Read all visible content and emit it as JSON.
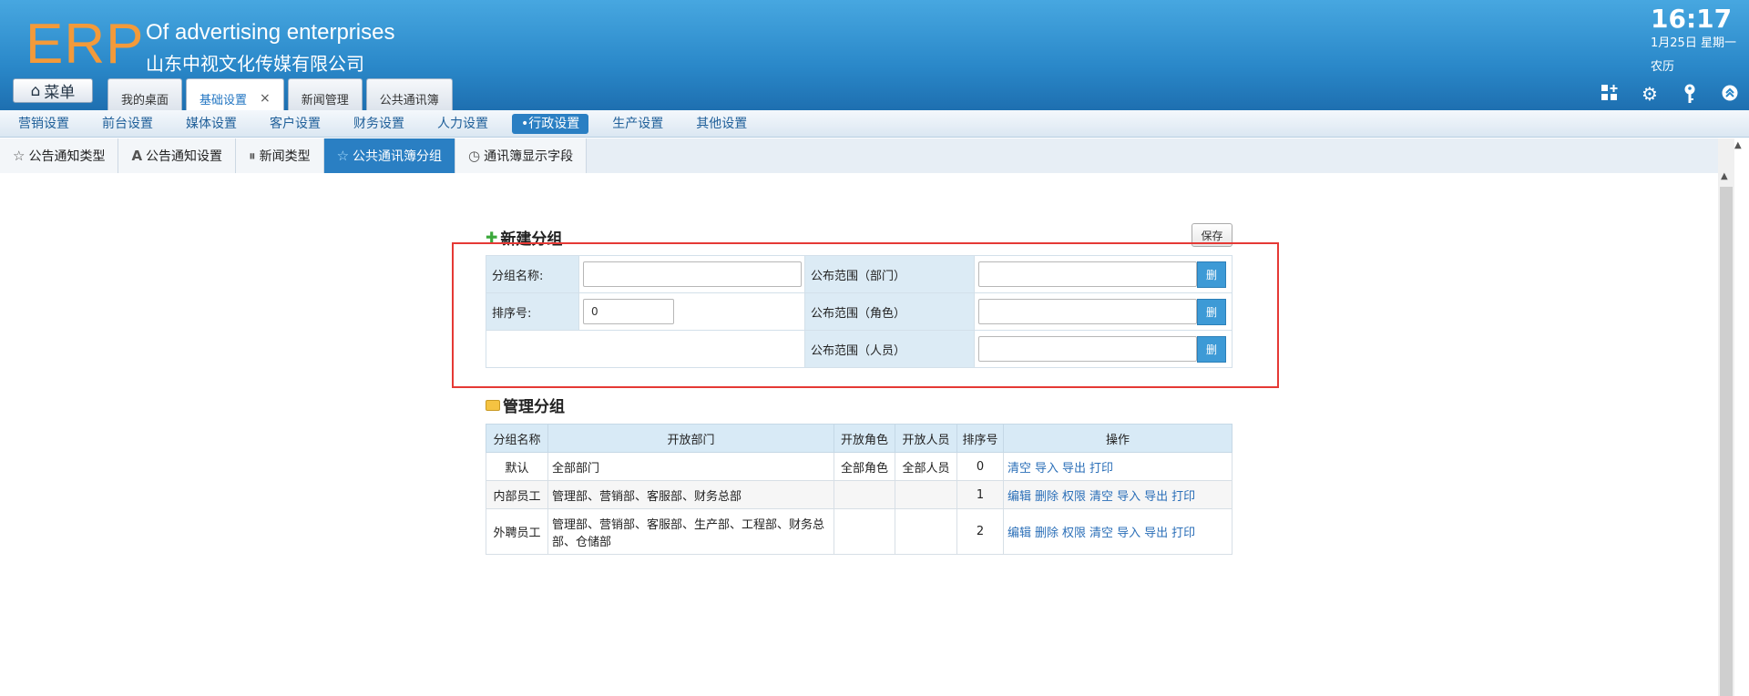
{
  "header": {
    "logo": "ERP",
    "brand_en": "Of advertising enterprises",
    "brand_cn": "山东中视文化传媒有限公司",
    "time": "16:17",
    "date": "1月25日 星期一",
    "lunar": "农历",
    "menu_label": "菜单",
    "tabs": [
      {
        "label": "我的桌面"
      },
      {
        "label": "基础设置",
        "close": "×"
      },
      {
        "label": "新闻管理"
      },
      {
        "label": "公共通讯簿"
      }
    ],
    "icons": [
      "grid-add-icon",
      "gear-icon",
      "key-icon",
      "collapse-up-icon"
    ]
  },
  "settings_nav": [
    "营销设置",
    "前台设置",
    "媒体设置",
    "客户设置",
    "财务设置",
    "人力设置",
    "•行政设置",
    "生产设置",
    "其他设置"
  ],
  "sub_tabs": [
    "公告通知类型",
    "公告通知设置",
    "新闻类型",
    "公共通讯簿分组",
    "通讯簿显示字段"
  ],
  "new_group": {
    "title": "新建分组",
    "save_label": "保存",
    "name_label": "分组名称:",
    "sort_label": "排序号:",
    "sort_value": "0",
    "dept_label": "公布范围（部门）",
    "role_label": "公布范围（角色）",
    "person_label": "公布范围（人员）",
    "select_label": "删"
  },
  "manage": {
    "title": "管理分组",
    "headers": [
      "分组名称",
      "开放部门",
      "开放角色",
      "开放人员",
      "排序号",
      "操作"
    ],
    "rows": [
      {
        "name": "默认",
        "dept": "全部部门",
        "role": "全部角色",
        "person": "全部人员",
        "sort": "0",
        "ops": [
          "清空",
          "导入",
          "导出",
          "打印"
        ]
      },
      {
        "name": "内部员工",
        "dept": "管理部、营销部、客服部、财务总部",
        "role": "",
        "person": "",
        "sort": "1",
        "ops": [
          "编辑",
          "删除",
          "权限",
          "清空",
          "导入",
          "导出",
          "打印"
        ]
      },
      {
        "name": "外聘员工",
        "dept": "管理部、营销部、客服部、生产部、工程部、财务总部、仓储部",
        "role": "",
        "person": "",
        "sort": "2",
        "ops": [
          "编辑",
          "删除",
          "权限",
          "清空",
          "导入",
          "导出",
          "打印"
        ]
      }
    ]
  }
}
